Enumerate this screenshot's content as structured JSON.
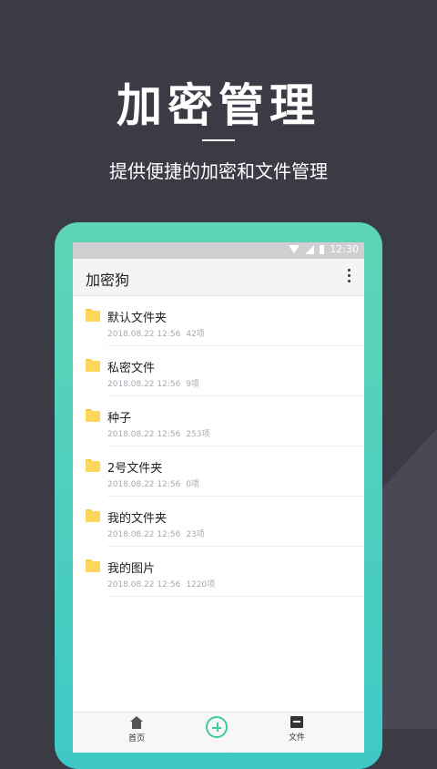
{
  "hero": {
    "title": "加密管理",
    "subtitle": "提供便捷的加密和文件管理"
  },
  "statusbar": {
    "time": "12:30"
  },
  "appbar": {
    "title": "加密狗",
    "menu_icon": "more-vert-icon"
  },
  "folders": [
    {
      "name": "默认文件夹",
      "date": "2018.08.22 12:56",
      "count": "42项"
    },
    {
      "name": "私密文件",
      "date": "2018.08.22 12:56",
      "count": "9项"
    },
    {
      "name": "种子",
      "date": "2018.08.22 12:56",
      "count": "253项"
    },
    {
      "name": "2号文件夹",
      "date": "2018.08.22 12:56",
      "count": "0项"
    },
    {
      "name": "我的文件夹",
      "date": "2018.08.22 12:56",
      "count": "23项"
    },
    {
      "name": "我的图片",
      "date": "2018.08.22 12:56",
      "count": "1220项"
    }
  ],
  "bottomnav": {
    "home_label": "首页",
    "files_label": "文件"
  },
  "colors": {
    "background": "#3a3b45",
    "accent": "#3ec9a0",
    "folder": "#ffd65c"
  }
}
